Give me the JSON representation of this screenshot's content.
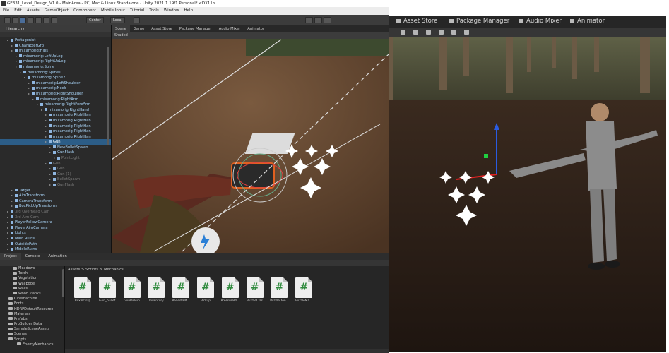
{
  "window_title": "GE331_Level_Design_V1.0 - MainArea - PC, Mac & Linux Standalone - Unity 2021.1.19f1 Personal* <DX11>",
  "menu": [
    "File",
    "Edit",
    "Assets",
    "GameObject",
    "Component",
    "Mobile Input",
    "Tutorial",
    "Tools",
    "Window",
    "Help"
  ],
  "toolbar": {
    "pivot": "Center",
    "space": "Local"
  },
  "hierarchy": {
    "tab": "Hierarchy",
    "rows": [
      {
        "t": "Protagonist",
        "d": 1,
        "s": "n"
      },
      {
        "t": "CharacterGrp",
        "d": 2,
        "s": "n"
      },
      {
        "t": "mixamorig:Hips",
        "d": 2,
        "s": "n"
      },
      {
        "t": "mixamorig:LeftUpLeg",
        "d": 3,
        "s": "n"
      },
      {
        "t": "mixamorig:RightUpLeg",
        "d": 3,
        "s": "n"
      },
      {
        "t": "mixamorig:Spine",
        "d": 3,
        "s": "n"
      },
      {
        "t": "mixamorig:Spine1",
        "d": 4,
        "s": "n"
      },
      {
        "t": "mixamorig:Spine2",
        "d": 5,
        "s": "n"
      },
      {
        "t": "mixamorig:LeftShoulder",
        "d": 6,
        "s": "n"
      },
      {
        "t": "mixamorig:Neck",
        "d": 6,
        "s": "n"
      },
      {
        "t": "mixamorig:RightShoulder",
        "d": 6,
        "s": "n"
      },
      {
        "t": "mixamorig:RightArm",
        "d": 7,
        "s": "n"
      },
      {
        "t": "mixamorig:RightForeArm",
        "d": 8,
        "s": "n"
      },
      {
        "t": "mixamorig:RightHand",
        "d": 9,
        "s": "n"
      },
      {
        "t": "mixamorig:RightHan",
        "d": 10,
        "s": "n"
      },
      {
        "t": "mixamorig:RightHan",
        "d": 10,
        "s": "n"
      },
      {
        "t": "mixamorig:RightHan",
        "d": 10,
        "s": "n"
      },
      {
        "t": "mixamorig:RightHan",
        "d": 10,
        "s": "n"
      },
      {
        "t": "mixamorig:RightHan",
        "d": 10,
        "s": "n"
      },
      {
        "t": "Gun",
        "d": 10,
        "s": "sel"
      },
      {
        "t": "NewBulletSpawn",
        "d": 11,
        "s": "n"
      },
      {
        "t": "GunFlash",
        "d": 11,
        "s": "n"
      },
      {
        "t": "PointLight",
        "d": 12,
        "s": "dim"
      },
      {
        "t": "Gun",
        "d": 10,
        "s": "dim"
      },
      {
        "t": "Gun",
        "d": 11,
        "s": "dim"
      },
      {
        "t": "Gun (1)",
        "d": 11,
        "s": "dim"
      },
      {
        "t": "BulletSpawn",
        "d": 11,
        "s": "dim"
      },
      {
        "t": "GunFlash",
        "d": 11,
        "s": "dim"
      },
      {
        "t": "Target",
        "d": 2,
        "s": "n"
      },
      {
        "t": "AimTransform",
        "d": 2,
        "s": "n"
      },
      {
        "t": "CameraTransform",
        "d": 2,
        "s": "n"
      },
      {
        "t": "BoxPickUpTransform",
        "d": 2,
        "s": "n"
      },
      {
        "t": "3rd Overhead Cam",
        "d": 1,
        "s": "dim"
      },
      {
        "t": "3rd Aim Cam",
        "d": 1,
        "s": "dim"
      },
      {
        "t": "PlayerFollowCamera",
        "d": 1,
        "s": "n"
      },
      {
        "t": "PlayerAimCamera",
        "d": 1,
        "s": "n"
      },
      {
        "t": "Lights",
        "d": 1,
        "s": "n"
      },
      {
        "t": "Main Ruins",
        "d": 1,
        "s": "n"
      },
      {
        "t": "OutsidePath",
        "d": 1,
        "s": "n"
      },
      {
        "t": "MiddleRuins",
        "d": 1,
        "s": "n"
      }
    ]
  },
  "scene": {
    "tabs": [
      "Scene",
      "Game",
      "Asset Store",
      "Package Manager",
      "Audio Mixer",
      "Animator"
    ],
    "shading": "Shaded"
  },
  "bottom": {
    "tabs": [
      "Project",
      "Console",
      "Animation"
    ],
    "tree": [
      "Meadows",
      "Torch",
      "Vegetation",
      "WallEdge",
      "Walls",
      "Wood Planks",
      "Cinemachine",
      "Fonts",
      "HDRPDefaultResource",
      "Materials",
      "Prefabs",
      "ProBuilder Data",
      "SampleSceneAssets",
      "Scenes",
      "Scripts",
      "EnemyMechanics"
    ],
    "breadcrumb": "Assets > Scripts > Mechanics",
    "files": [
      "BoxPickUp",
      "Gun_bullet",
      "GunPickup",
      "Inventory",
      "PedestalIt...",
      "Pickup",
      "PressurePl...",
      "PuzzleClas",
      "PuzzleDoo...",
      "PuzzleMa..."
    ]
  },
  "right_tabs": [
    "Asset Store",
    "Package Manager",
    "Audio Mixer",
    "Animator"
  ],
  "accent": "#2c5d87"
}
